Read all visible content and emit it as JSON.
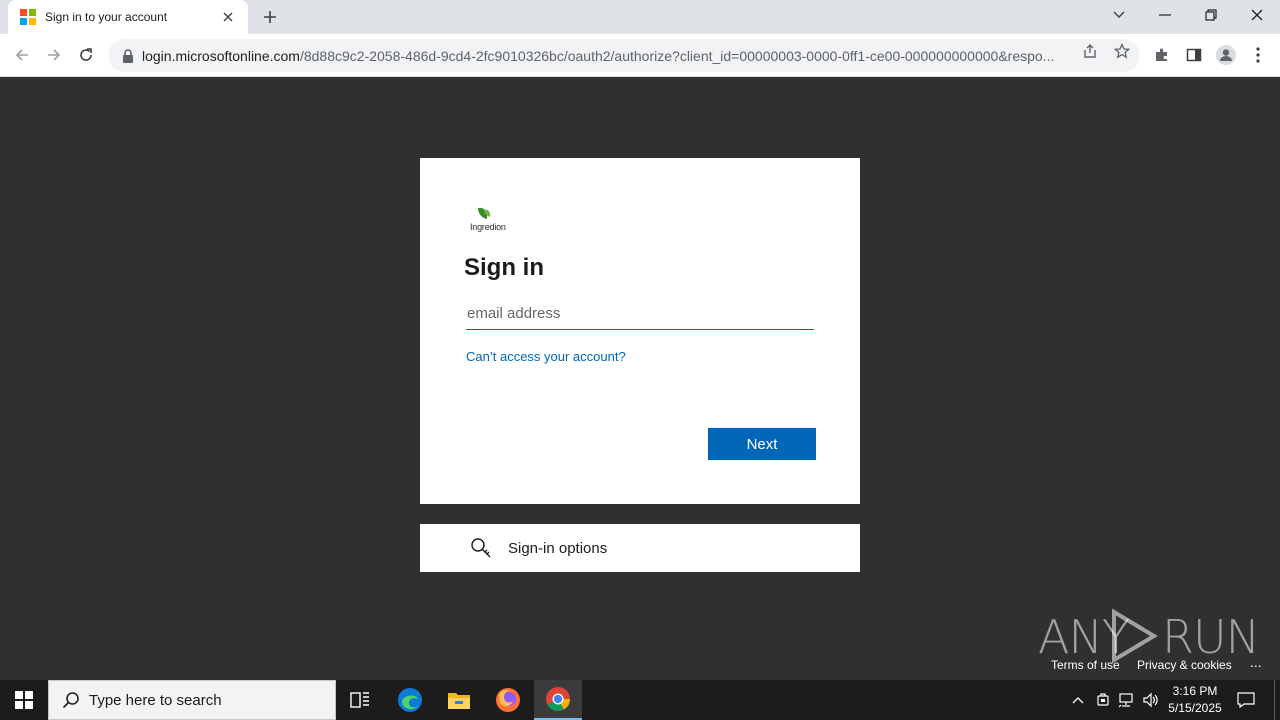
{
  "browser": {
    "tab_title": "Sign in to your account",
    "url_host": "login.microsoftonline.com",
    "url_path": "/8d88c9c2-2058-486d-9cd4-2fc9010326bc/oauth2/authorize?client_id=00000003-0000-0ff1-ce00-000000000000&respo..."
  },
  "signin": {
    "brand_text": "Ingredion",
    "title": "Sign in",
    "email_placeholder": "email address",
    "email_value": "",
    "cant_access": "Can’t access your account?",
    "next_label": "Next"
  },
  "options": {
    "label": "Sign-in options"
  },
  "footer": {
    "terms": "Terms of use",
    "privacy": "Privacy & cookies",
    "more": "..."
  },
  "watermark": {
    "left": "ANY",
    "right": "RUN"
  },
  "taskbar": {
    "search_placeholder": "Type here to search",
    "time": "3:16 PM",
    "date": "5/15/2025"
  },
  "colors": {
    "accent": "#0067b8",
    "page_bg": "#303033",
    "brand_green": "#3a8a2e"
  },
  "icons": [
    "windows-logo-icon",
    "search-icon",
    "task-view-icon",
    "edge-icon",
    "file-explorer-icon",
    "firefox-icon",
    "chrome-icon",
    "key-icon",
    "lock-icon",
    "star-icon",
    "share-icon",
    "extensions-icon",
    "side-panel-icon",
    "profile-icon",
    "menu-icon"
  ]
}
